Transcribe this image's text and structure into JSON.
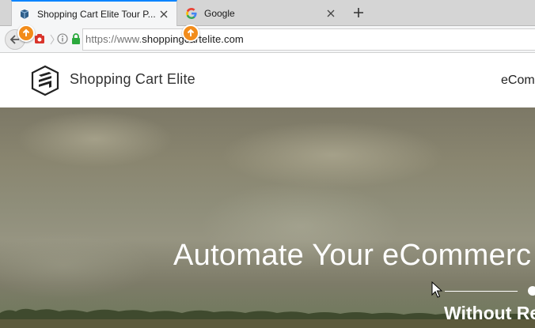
{
  "browser": {
    "tabs": [
      {
        "title": "Shopping Cart Elite Tour P...",
        "active": true,
        "favicon": "shopping-cart-elite-favicon"
      },
      {
        "title": "Google",
        "active": false,
        "favicon": "google-favicon"
      }
    ],
    "new_tab_icon": "plus-icon",
    "url_scheme": "https://www.",
    "url_host": "shoppingcartelite.com"
  },
  "site": {
    "brand": "Shopping Cart Elite",
    "nav_partial": "eCom",
    "hero": {
      "headline": "Automate Your eCommerc",
      "subhead": "Without Re"
    }
  },
  "colors": {
    "marker": "#f28c1b",
    "tab_accent": "#0a84ff",
    "lock": "#2aa83c"
  }
}
